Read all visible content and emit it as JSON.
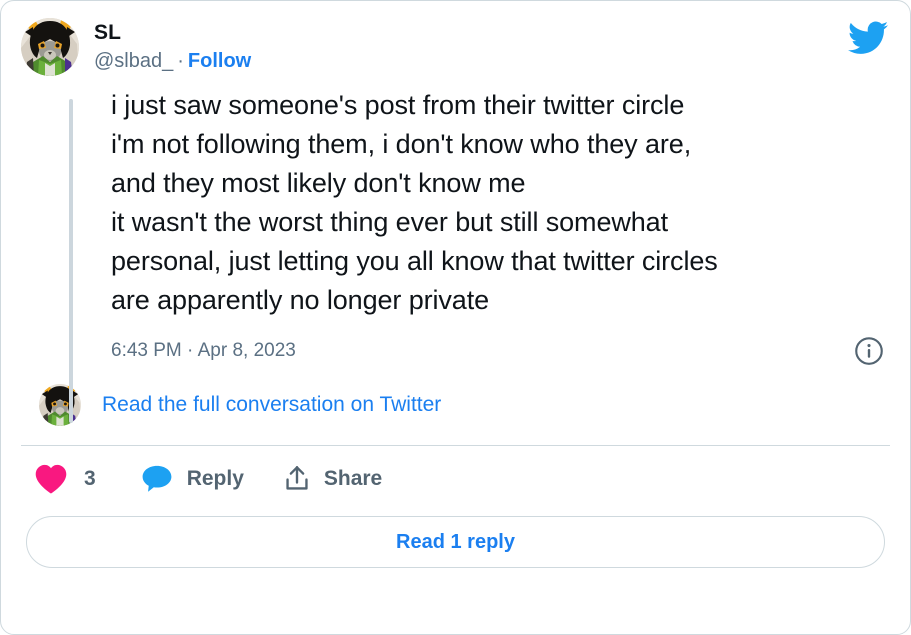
{
  "card": {
    "platform_logo": "twitter-bird-icon",
    "accent_color": "#1DA1F2",
    "link_color": "#1b7ff0",
    "like_color": "#F91880",
    "border_color": "#cfd9de"
  },
  "author": {
    "display_name": "SL",
    "handle": "@slbad_",
    "separator": "·",
    "follow_label": "Follow",
    "avatar_alt": "avatar"
  },
  "tweet": {
    "text": "i just saw someone's post from their twitter circle\ni'm not following them, i don't know who they are,\nand they most likely don't know me\nit wasn't the worst thing ever but still somewhat\npersonal, just letting you all know that twitter circles\nare apparently no longer private",
    "timestamp": "6:43 PM · Apr 8, 2023",
    "info_icon": "info-circle-icon"
  },
  "conversation": {
    "link_label": "Read the full conversation on Twitter"
  },
  "actions": {
    "like": {
      "icon": "heart-icon",
      "count": "3"
    },
    "reply": {
      "icon": "speech-bubble-icon",
      "label": "Reply"
    },
    "share": {
      "icon": "share-upload-icon",
      "label": "Share"
    }
  },
  "footer": {
    "read_replies_label": "Read 1 reply"
  }
}
